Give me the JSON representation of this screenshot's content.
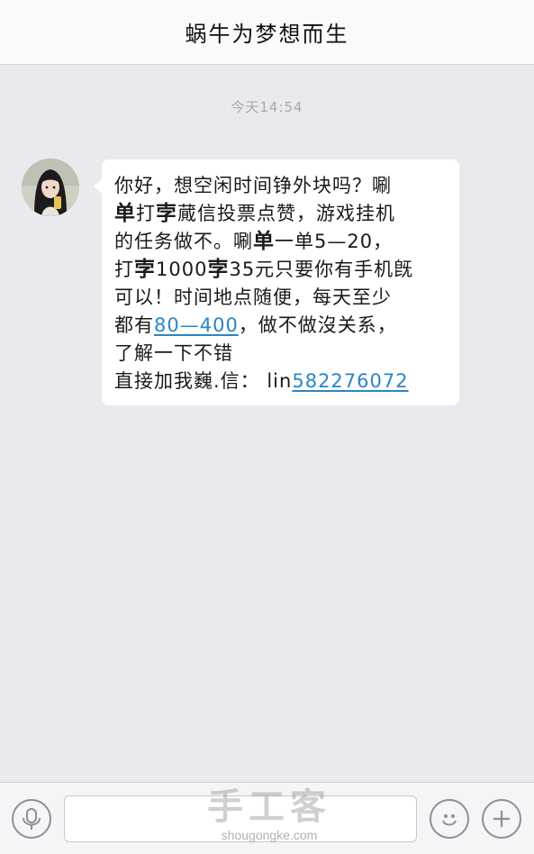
{
  "header": {
    "title": "蜗牛为梦想而生"
  },
  "chat": {
    "timestamp": "今天14:54",
    "message": {
      "lines": [
        [
          {
            "t": "你好，想空闲时间铮外块吗？唰"
          }
        ],
        [
          {
            "t": "单",
            "b": true
          },
          {
            "t": "打"
          },
          {
            "t": "孛",
            "b": true
          },
          {
            "t": "蕆信投票点赞，游戏挂机"
          }
        ],
        [
          {
            "t": "的任务做不。唰"
          },
          {
            "t": "单",
            "b": true
          },
          {
            "t": "一单5—20，"
          }
        ],
        [
          {
            "t": "打"
          },
          {
            "t": "孛",
            "b": true
          },
          {
            "t": "1000"
          },
          {
            "t": "孛",
            "b": true
          },
          {
            "t": "35元只要你有手机旣"
          }
        ],
        [
          {
            "t": "可以！时间地点随便，每天至少"
          }
        ],
        [
          {
            "t": "都有"
          },
          {
            "t": "80—400",
            "link": true
          },
          {
            "t": "，做不做沒关系，"
          }
        ],
        [
          {
            "t": "了解一下不错"
          }
        ],
        [
          {
            "t": "直接加我巍.信：  lin"
          },
          {
            "t": "582276072",
            "link": true
          }
        ]
      ]
    }
  },
  "input_bar": {
    "voice_icon": "microphone-icon",
    "emoji_icon": "smiley-icon",
    "plus_icon": "plus-icon"
  },
  "watermark": {
    "logo": "手工客",
    "url": "shougongke.com"
  },
  "colors": {
    "background": "#e9eaee",
    "bubble": "#ffffff",
    "link": "#2a86c8",
    "timestamp": "#a7a9ad"
  }
}
